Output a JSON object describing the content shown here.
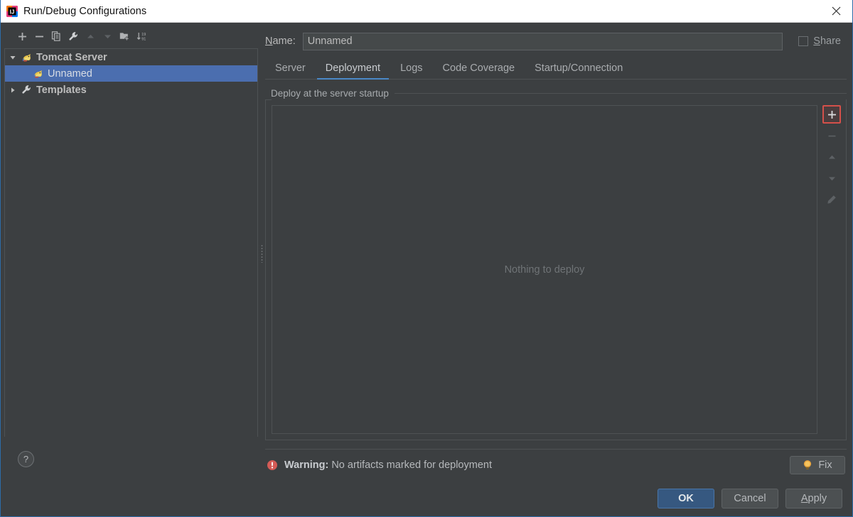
{
  "window": {
    "title": "Run/Debug Configurations",
    "app_icon": "intellij-idea-logo",
    "close_icon": "close-icon"
  },
  "left_toolbar": {
    "buttons": [
      {
        "name": "add-configuration-button",
        "icon": "plus-icon",
        "enabled": true
      },
      {
        "name": "remove-configuration-button",
        "icon": "minus-icon",
        "enabled": true
      },
      {
        "name": "copy-configuration-button",
        "icon": "copy-icon",
        "enabled": true
      },
      {
        "name": "edit-templates-button",
        "icon": "wrench-icon",
        "enabled": true
      },
      {
        "name": "move-up-button",
        "icon": "arrow-up-icon",
        "enabled": false
      },
      {
        "name": "move-down-button",
        "icon": "arrow-down-icon",
        "enabled": false
      },
      {
        "name": "create-folder-button",
        "icon": "folder-add-icon",
        "enabled": true
      },
      {
        "name": "sort-configurations-button",
        "icon": "sort-alpha-icon",
        "enabled": true
      }
    ]
  },
  "tree": {
    "nodes": [
      {
        "label": "Tomcat Server",
        "icon": "tomcat-icon",
        "expanded": true,
        "group": true,
        "selected": false,
        "indent": 0
      },
      {
        "label": "Unnamed",
        "icon": "tomcat-icon",
        "expanded": null,
        "group": false,
        "selected": true,
        "indent": 1
      },
      {
        "label": "Templates",
        "icon": "wrench-icon",
        "expanded": false,
        "group": true,
        "selected": false,
        "indent": 0
      }
    ]
  },
  "help": {
    "label": "?",
    "icon": "question-mark-icon"
  },
  "name_field": {
    "label_prefix": "N",
    "label_rest": "ame:",
    "value": "Unnamed",
    "placeholder": "Unnamed"
  },
  "share": {
    "label_prefix": "S",
    "label_rest": "hare",
    "checked": false
  },
  "tabs": [
    {
      "label": "Server",
      "active": false
    },
    {
      "label": "Deployment",
      "active": true
    },
    {
      "label": "Logs",
      "active": false
    },
    {
      "label": "Code Coverage",
      "active": false
    },
    {
      "label": "Startup/Connection",
      "active": false
    }
  ],
  "deployment": {
    "group_title": "Deploy at the server startup",
    "empty_text": "Nothing to deploy",
    "actions": [
      {
        "name": "add-artifact-button",
        "icon": "plus-icon",
        "enabled": true,
        "highlighted": true
      },
      {
        "name": "remove-artifact-button",
        "icon": "minus-icon",
        "enabled": false,
        "highlighted": false
      },
      {
        "name": "move-artifact-up-button",
        "icon": "arrow-up-icon",
        "enabled": false,
        "highlighted": false
      },
      {
        "name": "move-artifact-down-button",
        "icon": "arrow-down-icon",
        "enabled": false,
        "highlighted": false
      },
      {
        "name": "edit-artifact-button",
        "icon": "pencil-icon",
        "enabled": false,
        "highlighted": false
      }
    ]
  },
  "warning": {
    "icon": "error-circle-icon",
    "label": "Warning:",
    "message": "No artifacts marked for deployment",
    "fix_button": {
      "label": "Fix",
      "icon": "lightbulb-icon"
    }
  },
  "footer_buttons": [
    {
      "name": "ok-button",
      "label": "OK",
      "style": "default",
      "mnemonic": ""
    },
    {
      "name": "cancel-button",
      "label": "Cancel",
      "style": "normal",
      "mnemonic": ""
    },
    {
      "name": "apply-button",
      "label_prefix": "A",
      "label_rest": "pply",
      "style": "normal",
      "mnemonic": "A"
    }
  ],
  "colors": {
    "background": "#3c3f41",
    "selection": "#4b6eaf",
    "accent_tab": "#4a88c7",
    "default_button": "#365880",
    "highlight_border": "#d4504a",
    "warning_icon": "#d45b56",
    "titlebar": "#ffffff"
  }
}
